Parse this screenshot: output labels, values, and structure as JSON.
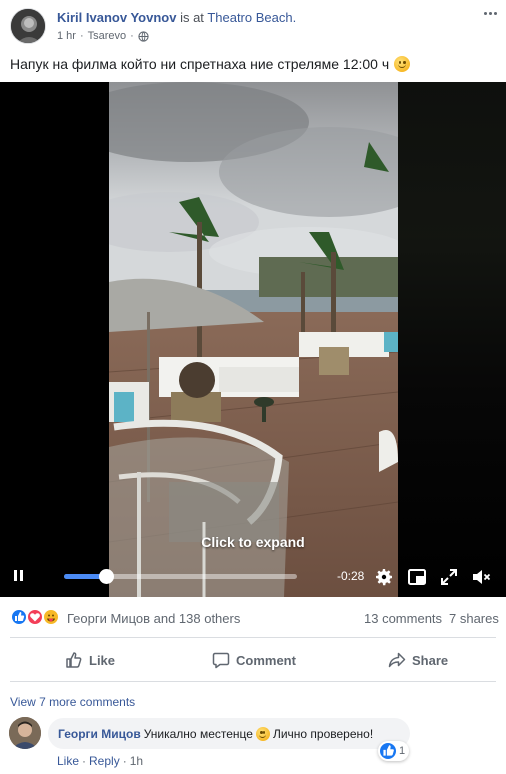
{
  "post": {
    "author": "Kiril Ivanov Yovnov",
    "action_text": "is at",
    "place": "Theatro Beach.",
    "time": "1 hr",
    "location": "Tsarevo",
    "text": "Напук на филма който ни спретнаха ние стреляме 12:00 ч"
  },
  "video": {
    "overlay_text": "Click to expand",
    "time_remaining": "-0:28",
    "progress": 0.18
  },
  "reactions": {
    "names": "Георги Мицов and 138 others",
    "comments_count": "13 comments",
    "shares_count": "7 shares"
  },
  "actions": {
    "like": "Like",
    "comment": "Comment",
    "share": "Share"
  },
  "comments": {
    "view_more": "View 7 more comments",
    "items": [
      {
        "author": "Георги Мицов",
        "text_before": "Уникално местенце",
        "text_after": "Лично проверено!",
        "like_count": "1",
        "like_label": "Like",
        "reply_label": "Reply",
        "time": "1h"
      }
    ]
  },
  "colors": {
    "link": "#385898",
    "progress": "#4b8bf5",
    "like_blue": "#1877f2",
    "love_red": "#f33e58",
    "haha_yellow": "#f7b928"
  }
}
